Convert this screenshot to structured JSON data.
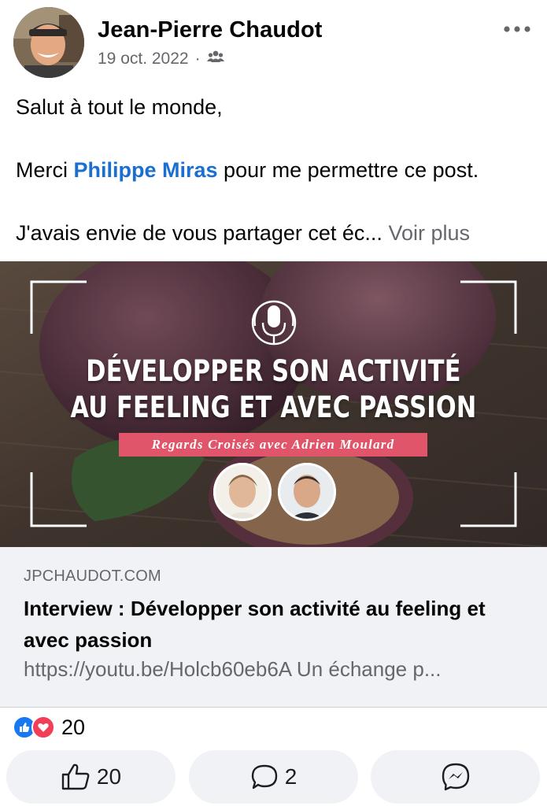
{
  "post": {
    "author": "Jean-Pierre Chaudot",
    "date": "19 oct. 2022",
    "meta_separator": "·",
    "audience_icon": "group-icon",
    "more_icon": "more-horizontal-icon",
    "text": {
      "greeting": "Salut à tout le monde,",
      "thanks_prefix": "Merci ",
      "mention": "Philippe Miras",
      "thanks_suffix": " pour me permettre ce post.",
      "excerpt": "J'avais envie de vous partager cet éc...",
      "see_more": "Voir plus"
    }
  },
  "link_preview": {
    "image": {
      "title_line1": "DÉVELOPPER SON ACTIVITÉ",
      "title_line2": "AU FEELING ET AVEC PASSION",
      "banner": "Regards Croisés avec Adrien Moulard",
      "icon": "microphone-icon"
    },
    "domain": "JPCHAUDOT.COM",
    "title": "Interview : Développer son activité au feeling et avec passion",
    "description": "https://youtu.be/Holcb60eb6A Un échange p..."
  },
  "reactions": {
    "icons": [
      "like-icon",
      "love-icon"
    ],
    "count": "20"
  },
  "actions": {
    "like": {
      "icon": "thumbs-up-icon",
      "count": "20"
    },
    "comment": {
      "icon": "comment-icon",
      "count": "2"
    },
    "share": {
      "icon": "messenger-icon"
    }
  },
  "colors": {
    "mention": "#1b6fd0",
    "secondary_text": "#65676b",
    "like_blue": "#1877f2",
    "love_red": "#f33e58",
    "banner_pink": "#e0556a",
    "button_bg": "#f0f2f5"
  }
}
